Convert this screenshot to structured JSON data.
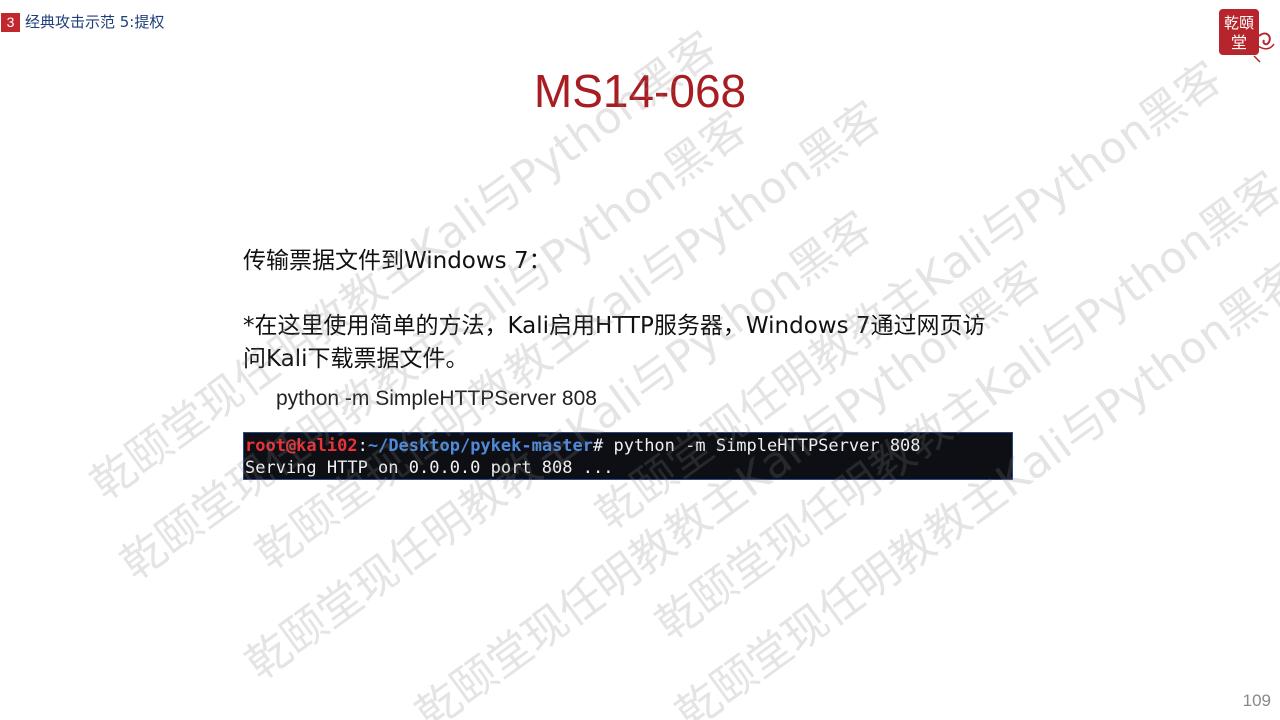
{
  "header": {
    "section_number": "3",
    "section_title": "经典攻击示范 5:提权"
  },
  "logo": {
    "text_top": "乾頤",
    "text_bottom": "堂",
    "color": "#b5252b"
  },
  "slide": {
    "title": "MS14-068",
    "paragraph_1": "传输票据文件到Windows 7：",
    "paragraph_2": "*在这里使用简单的方法，Kali启用HTTP服务器，Windows 7通过网页访问Kali下载票据文件。",
    "command": "python -m SimpleHTTPServer 808"
  },
  "terminal": {
    "prompt_user": "root@kali02",
    "prompt_sep": ":",
    "prompt_path": "~/Desktop/pykek-master",
    "prompt_cmd": "# python -m SimpleHTTPServer 808",
    "output_line": "Serving HTTP on 0.0.0.0 port 808 ..."
  },
  "watermark": {
    "text": "乾颐堂现任明教教主Kali与Python黑客"
  },
  "footer": {
    "page_number": "109"
  },
  "colors": {
    "title": "#a71d22",
    "section_badge": "#c0282d",
    "section_title": "#1f3f7a",
    "terminal_bg": "#0d0f14",
    "terminal_user": "#e8333a",
    "terminal_path": "#4f8ad9"
  }
}
